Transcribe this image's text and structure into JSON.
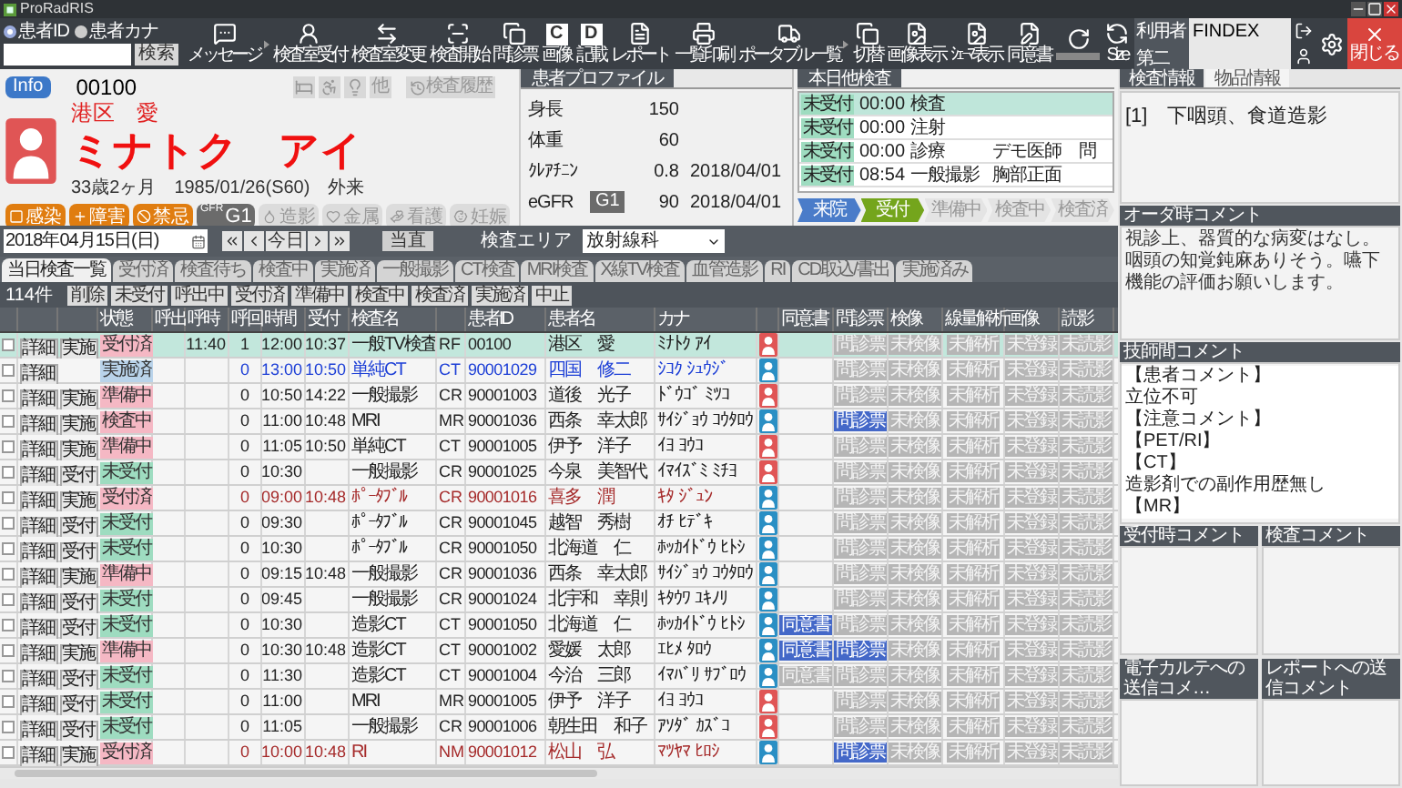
{
  "window": {
    "title": "ProRadRIS"
  },
  "search": {
    "modes": [
      {
        "label": "患者ID",
        "selected": true
      },
      {
        "label": "患者カナ",
        "selected": false
      }
    ],
    "button": "検索"
  },
  "toolbar": [
    {
      "kind": "icon",
      "label": "メッセージ"
    },
    {
      "kind": "icon",
      "label": "検査室受付"
    },
    {
      "kind": "icon",
      "label": "検査室変更"
    },
    {
      "kind": "icon",
      "label": "検査開始"
    },
    {
      "kind": "icon",
      "label": "問診票"
    },
    {
      "kind": "letter",
      "label": "画像",
      "glyph": "C"
    },
    {
      "kind": "letter",
      "label": "記載",
      "glyph": "D"
    },
    {
      "kind": "icon",
      "label": "レポート"
    },
    {
      "kind": "icon",
      "label": "一覧印刷"
    },
    {
      "kind": "icon",
      "label": "ポータブル一覧"
    },
    {
      "kind": "icon",
      "label": "切替"
    },
    {
      "kind": "icon",
      "label": "画像表示"
    },
    {
      "kind": "icon",
      "label": "ｼｪｰﾏ表示"
    },
    {
      "kind": "icon",
      "label": "同意書"
    },
    {
      "kind": "blank"
    },
    {
      "kind": "icon",
      "label": "Size"
    }
  ],
  "user": {
    "label": "利用者",
    "value": "FINDEX",
    "label2": "第二"
  },
  "close_button": "閉じる",
  "patient": {
    "info_badge": "Info",
    "id": "00100",
    "other_button": "他",
    "history_button": "検査履歴",
    "name": "港区　愛",
    "kana": "ミナトク　アイ",
    "avatar": {
      "color": "#e05555"
    },
    "age": "33歳2ヶ月",
    "birth": "1985/01/26(S60)",
    "visit": "外来",
    "flags": [
      {
        "kind": "flag",
        "label": "感染",
        "active": true
      },
      {
        "kind": "flag",
        "label": "障害",
        "active": true
      },
      {
        "kind": "flag",
        "label": "禁忌",
        "active": true
      },
      {
        "kind": "gfr",
        "small": "GFR",
        "label": "G1"
      },
      {
        "kind": "flag",
        "label": "造影",
        "active": false
      },
      {
        "kind": "flag",
        "label": "金属",
        "active": false
      },
      {
        "kind": "flag",
        "label": "看護",
        "active": false
      },
      {
        "kind": "flag",
        "label": "妊娠",
        "active": false
      }
    ]
  },
  "profile": {
    "title": "患者プロファイル",
    "rows": [
      {
        "label": "身長",
        "value": "150"
      },
      {
        "label": "体重",
        "value": "60"
      },
      {
        "label": "ｸﾚｱﾁﾆﾝ",
        "value": "0.8",
        "date": "2018/04/01"
      },
      {
        "label": "eGFR",
        "grade": "G1",
        "value": "90",
        "date": "2018/04/01"
      }
    ]
  },
  "today": {
    "title": "本日他検査",
    "rows": [
      {
        "status": "未受付",
        "time": "00:00",
        "exam": "検査",
        "selected": true
      },
      {
        "status": "未受付",
        "time": "00:00",
        "exam": "注射",
        "selected": false
      },
      {
        "status": "未受付",
        "time": "00:00",
        "exam": "診療",
        "note": "デモ医師　問",
        "selected": false
      },
      {
        "status": "未受付",
        "time": "08:54",
        "exam": "一般撮影",
        "note": "胸部正面",
        "selected": false
      }
    ],
    "steps": [
      {
        "label": "来院",
        "kind": "done"
      },
      {
        "label": "受付",
        "kind": "current"
      },
      {
        "label": "準備中",
        "kind": "todo"
      },
      {
        "label": "検査中",
        "kind": "todo"
      },
      {
        "label": "検査済",
        "kind": "todo"
      }
    ]
  },
  "date_bar": {
    "date": "2018年04月15日(日)",
    "today_button": "今日",
    "duty_button": "当直",
    "area_label": "検査エリア",
    "area_value": "放射線科"
  },
  "tabs": [
    {
      "label": "当日検査一覧",
      "selected": true
    },
    {
      "label": "受付済",
      "selected": false
    },
    {
      "label": "検査待ち",
      "selected": false
    },
    {
      "label": "検査中",
      "selected": false
    },
    {
      "label": "実施済",
      "selected": false
    },
    {
      "label": "一般撮影",
      "selected": false
    },
    {
      "label": "CT検査",
      "selected": false
    },
    {
      "label": "MRI検査",
      "selected": false
    },
    {
      "label": "X線TV検査",
      "selected": false
    },
    {
      "label": "血管造影",
      "selected": false
    },
    {
      "label": "RI",
      "selected": false
    },
    {
      "label": "CD取込/書出",
      "selected": false
    },
    {
      "label": "実施済み",
      "selected": false
    }
  ],
  "count": "114件",
  "filters": [
    "削除",
    "未受付",
    "呼出中",
    "受付済",
    "準備中",
    "検査中",
    "検査済",
    "実施済",
    "中止"
  ],
  "table": {
    "columns": [
      "状態",
      "呼出",
      "呼時",
      "呼回",
      "時間",
      "受付",
      "検査名",
      "患者ID",
      "患者名",
      "カナ",
      "同意書",
      "問診票",
      "検像",
      "線量解析",
      "画像",
      "読影"
    ],
    "rows": [
      {
        "checked": false,
        "selected": true,
        "kind": "normal",
        "detail": "詳細",
        "action": "実施",
        "status": {
          "label": "受付済",
          "color": "#f5b8c4"
        },
        "call_time": "11:40",
        "call_count": "1",
        "time": "12:00",
        "reception": "10:37",
        "exam": "一般TV検査",
        "modality": "RF",
        "patient_id": "00100",
        "name": "港区　愛",
        "kana": "ﾐﾅﾄｸ ｱｲ",
        "avatar": {
          "color": "#e05555"
        },
        "docs": [
          {
            "label": "問診票",
            "active": false
          },
          {
            "label": "未検像",
            "active": false
          },
          {
            "label": "未解析",
            "active": false
          },
          {
            "label": "未登録",
            "active": false
          },
          {
            "label": "未読影",
            "active": false
          }
        ]
      },
      {
        "checked": false,
        "selected": false,
        "kind": "done",
        "detail": "詳細",
        "status": {
          "label": "実施済",
          "color": "#b9d3ea"
        },
        "call_count": "0",
        "time": "13:00",
        "reception": "10:50",
        "exam": "単純CT",
        "modality": "CT",
        "patient_id": "90001029",
        "name": "四国　修二",
        "kana": "ｼｺｸ ｼｭｳｼﾞ",
        "avatar": {
          "color": "#2a8fc4"
        },
        "docs": [
          {
            "label": "問診票",
            "active": false
          },
          {
            "label": "未検像",
            "active": false
          },
          {
            "label": "未解析",
            "active": false
          },
          {
            "label": "未登録",
            "active": false
          },
          {
            "label": "未読影",
            "active": false
          }
        ]
      },
      {
        "checked": false,
        "selected": false,
        "kind": "normal",
        "detail": "詳細",
        "action": "実施",
        "status": {
          "label": "準備中",
          "color": "#f5b8c4"
        },
        "call_count": "0",
        "time": "10:50",
        "reception": "14:22",
        "exam": "一般撮影",
        "modality": "CR",
        "patient_id": "90001003",
        "name": "道後　光子",
        "kana": "ﾄﾞｳｺﾞ ﾐﾂｺ",
        "avatar": {
          "color": "#e05555"
        },
        "docs": [
          {
            "label": "問診票",
            "active": false
          },
          {
            "label": "未検像",
            "active": false
          },
          {
            "label": "未解析",
            "active": false
          },
          {
            "label": "未登録",
            "active": false
          },
          {
            "label": "未読影",
            "active": false
          }
        ]
      },
      {
        "checked": false,
        "selected": false,
        "kind": "normal",
        "detail": "詳細",
        "action": "実施",
        "status": {
          "label": "検査中",
          "color": "#f5b8c4"
        },
        "call_count": "0",
        "time": "11:00",
        "reception": "10:48",
        "exam": "MRI",
        "modality": "MR",
        "patient_id": "90001036",
        "name": "西条　幸太郎",
        "kana": "ｻｲｼﾞｮｳ ｺｳﾀﾛｳ",
        "avatar": {
          "color": "#2a8fc4"
        },
        "docs": [
          {
            "label": "問診票",
            "active": true
          },
          {
            "label": "未検像",
            "active": false
          },
          {
            "label": "未解析",
            "active": false
          },
          {
            "label": "未登録",
            "active": false
          },
          {
            "label": "未読影",
            "active": false
          }
        ]
      },
      {
        "checked": false,
        "selected": false,
        "kind": "normal",
        "detail": "詳細",
        "action": "実施",
        "status": {
          "label": "準備中",
          "color": "#f5b8c4"
        },
        "call_count": "0",
        "time": "11:05",
        "reception": "10:50",
        "exam": "単純CT",
        "modality": "CT",
        "patient_id": "90001005",
        "name": "伊予　洋子",
        "kana": "ｲﾖ ﾖｳｺ",
        "avatar": {
          "color": "#e05555"
        },
        "docs": [
          {
            "label": "問診票",
            "active": false
          },
          {
            "label": "未検像",
            "active": false
          },
          {
            "label": "未解析",
            "active": false
          },
          {
            "label": "未登録",
            "active": false
          },
          {
            "label": "未読影",
            "active": false
          }
        ]
      },
      {
        "checked": false,
        "selected": false,
        "kind": "normal",
        "detail": "詳細",
        "action": "受付",
        "status": {
          "label": "未受付",
          "color": "#9edcc0"
        },
        "call_count": "0",
        "time": "10:30",
        "exam": "一般撮影",
        "modality": "CR",
        "patient_id": "90001025",
        "name": "今泉　美智代",
        "kana": "ｲﾏｲｽﾞﾐ ﾐﾁﾖ",
        "avatar": {
          "color": "#e05555"
        },
        "docs": [
          {
            "label": "問診票",
            "active": false
          },
          {
            "label": "未検像",
            "active": false
          },
          {
            "label": "未解析",
            "active": false
          },
          {
            "label": "未登録",
            "active": false
          },
          {
            "label": "未読影",
            "active": false
          }
        ]
      },
      {
        "checked": false,
        "selected": false,
        "kind": "received",
        "detail": "詳細",
        "action": "実施",
        "status": {
          "label": "受付済",
          "color": "#f5b8c4"
        },
        "call_count": "0",
        "time": "09:00",
        "reception": "10:48",
        "exam": "ﾎﾟｰﾀﾌﾞﾙ",
        "modality": "CR",
        "patient_id": "90001016",
        "name": "喜多　潤",
        "kana": "ｷﾀ ｼﾞｭﾝ",
        "avatar": {
          "color": "#2a8fc4"
        },
        "docs": [
          {
            "label": "問診票",
            "active": false
          },
          {
            "label": "未検像",
            "active": false
          },
          {
            "label": "未解析",
            "active": false
          },
          {
            "label": "未登録",
            "active": false
          },
          {
            "label": "未読影",
            "active": false
          }
        ]
      },
      {
        "checked": false,
        "selected": false,
        "kind": "normal",
        "detail": "詳細",
        "action": "受付",
        "status": {
          "label": "未受付",
          "color": "#9edcc0"
        },
        "call_count": "0",
        "time": "09:30",
        "exam": "ﾎﾟｰﾀﾌﾞﾙ",
        "modality": "CR",
        "patient_id": "90001045",
        "name": "越智　秀樹",
        "kana": "ｵﾁ ﾋﾃﾞｷ",
        "avatar": {
          "color": "#2a8fc4"
        },
        "docs": [
          {
            "label": "問診票",
            "active": false
          },
          {
            "label": "未検像",
            "active": false
          },
          {
            "label": "未解析",
            "active": false
          },
          {
            "label": "未登録",
            "active": false
          },
          {
            "label": "未読影",
            "active": false
          }
        ]
      },
      {
        "checked": false,
        "selected": false,
        "kind": "normal",
        "detail": "詳細",
        "action": "受付",
        "status": {
          "label": "未受付",
          "color": "#9edcc0"
        },
        "call_count": "0",
        "time": "10:30",
        "exam": "ﾎﾟｰﾀﾌﾞﾙ",
        "modality": "CR",
        "patient_id": "90001050",
        "name": "北海道　仁",
        "kana": "ﾎｯｶｲﾄﾞｳ ﾋﾄｼ",
        "avatar": {
          "color": "#2a8fc4"
        },
        "docs": [
          {
            "label": "問診票",
            "active": false
          },
          {
            "label": "未検像",
            "active": false
          },
          {
            "label": "未解析",
            "active": false
          },
          {
            "label": "未登録",
            "active": false
          },
          {
            "label": "未読影",
            "active": false
          }
        ]
      },
      {
        "checked": false,
        "selected": false,
        "kind": "normal",
        "detail": "詳細",
        "action": "実施",
        "status": {
          "label": "準備中",
          "color": "#f5b8c4"
        },
        "call_count": "0",
        "time": "09:15",
        "reception": "10:48",
        "exam": "一般撮影",
        "modality": "CR",
        "patient_id": "90001036",
        "name": "西条　幸太郎",
        "kana": "ｻｲｼﾞｮｳ ｺｳﾀﾛｳ",
        "avatar": {
          "color": "#2a8fc4"
        },
        "docs": [
          {
            "label": "問診票",
            "active": false
          },
          {
            "label": "未検像",
            "active": false
          },
          {
            "label": "未解析",
            "active": false
          },
          {
            "label": "未登録",
            "active": false
          },
          {
            "label": "未読影",
            "active": false
          }
        ]
      },
      {
        "checked": false,
        "selected": false,
        "kind": "normal",
        "detail": "詳細",
        "action": "受付",
        "status": {
          "label": "未受付",
          "color": "#9edcc0"
        },
        "call_count": "0",
        "time": "09:45",
        "exam": "一般撮影",
        "modality": "CR",
        "patient_id": "90001024",
        "name": "北宇和　幸則",
        "kana": "ｷﾀｳﾜ ﾕｷﾉﾘ",
        "avatar": {
          "color": "#2a8fc4"
        },
        "docs": [
          {
            "label": "問診票",
            "active": false
          },
          {
            "label": "未検像",
            "active": false
          },
          {
            "label": "未解析",
            "active": false
          },
          {
            "label": "未登録",
            "active": false
          },
          {
            "label": "未読影",
            "active": false
          }
        ]
      },
      {
        "checked": false,
        "selected": false,
        "kind": "normal",
        "detail": "詳細",
        "action": "受付",
        "status": {
          "label": "未受付",
          "color": "#9edcc0"
        },
        "call_count": "0",
        "time": "10:30",
        "exam": "造影CT",
        "modality": "CT",
        "patient_id": "90001050",
        "name": "北海道　仁",
        "kana": "ﾎｯｶｲﾄﾞｳ ﾋﾄｼ",
        "avatar": {
          "color": "#2a8fc4"
        },
        "consent": {
          "label": "同意書",
          "active": true
        },
        "docs": [
          {
            "label": "問診票",
            "active": false
          },
          {
            "label": "未検像",
            "active": false
          },
          {
            "label": "未解析",
            "active": false
          },
          {
            "label": "未登録",
            "active": false
          },
          {
            "label": "未読影",
            "active": false
          }
        ]
      },
      {
        "checked": false,
        "selected": false,
        "kind": "normal",
        "detail": "詳細",
        "action": "実施",
        "status": {
          "label": "準備中",
          "color": "#f5b8c4"
        },
        "call_count": "0",
        "time": "10:30",
        "reception": "10:48",
        "exam": "造影CT",
        "modality": "CT",
        "patient_id": "90001002",
        "name": "愛媛　太郎",
        "kana": "ｴﾋﾒ ﾀﾛｳ",
        "avatar": {
          "color": "#2a8fc4"
        },
        "consent": {
          "label": "同意書",
          "active": true
        },
        "docs": [
          {
            "label": "問診票",
            "active": true
          },
          {
            "label": "未検像",
            "active": false
          },
          {
            "label": "未解析",
            "active": false
          },
          {
            "label": "未登録",
            "active": false
          },
          {
            "label": "未読影",
            "active": false
          }
        ]
      },
      {
        "checked": false,
        "selected": false,
        "kind": "normal",
        "detail": "詳細",
        "action": "受付",
        "status": {
          "label": "未受付",
          "color": "#9edcc0"
        },
        "call_count": "0",
        "time": "11:30",
        "exam": "造影CT",
        "modality": "CT",
        "patient_id": "90001004",
        "name": "今治　三郎",
        "kana": "ｲﾏﾊﾞﾘ ｻﾌﾞﾛｳ",
        "avatar": {
          "color": "#2a8fc4"
        },
        "consent": {
          "label": "同意書",
          "active": false
        },
        "docs": [
          {
            "label": "問診票",
            "active": false
          },
          {
            "label": "未検像",
            "active": false
          },
          {
            "label": "未解析",
            "active": false
          },
          {
            "label": "未登録",
            "active": false
          },
          {
            "label": "未読影",
            "active": false
          }
        ]
      },
      {
        "checked": false,
        "selected": false,
        "kind": "normal",
        "detail": "詳細",
        "action": "受付",
        "status": {
          "label": "未受付",
          "color": "#9edcc0"
        },
        "call_count": "0",
        "time": "11:00",
        "exam": "MRI",
        "modality": "MR",
        "patient_id": "90001005",
        "name": "伊予　洋子",
        "kana": "ｲﾖ ﾖｳｺ",
        "avatar": {
          "color": "#e05555"
        },
        "docs": [
          {
            "label": "問診票",
            "active": false
          },
          {
            "label": "未検像",
            "active": false
          },
          {
            "label": "未解析",
            "active": false
          },
          {
            "label": "未登録",
            "active": false
          },
          {
            "label": "未読影",
            "active": false
          }
        ]
      },
      {
        "checked": false,
        "selected": false,
        "kind": "normal",
        "detail": "詳細",
        "action": "受付",
        "status": {
          "label": "未受付",
          "color": "#9edcc0"
        },
        "call_count": "0",
        "time": "11:05",
        "exam": "一般撮影",
        "modality": "CR",
        "patient_id": "90001006",
        "name": "朝生田　和子",
        "kana": "ｱｿﾀﾞ ｶｽﾞｺ",
        "avatar": {
          "color": "#e05555"
        },
        "docs": [
          {
            "label": "問診票",
            "active": false
          },
          {
            "label": "未検像",
            "active": false
          },
          {
            "label": "未解析",
            "active": false
          },
          {
            "label": "未登録",
            "active": false
          },
          {
            "label": "未読影",
            "active": false
          }
        ]
      },
      {
        "checked": false,
        "selected": false,
        "kind": "received",
        "detail": "詳細",
        "action": "実施",
        "status": {
          "label": "受付済",
          "color": "#f5b8c4"
        },
        "call_count": "0",
        "time": "10:00",
        "reception": "10:48",
        "exam": "RI",
        "modality": "NM",
        "patient_id": "90001012",
        "name": "松山　弘",
        "kana": "ﾏﾂﾔﾏ ﾋﾛｼ",
        "avatar": {
          "color": "#2a8fc4"
        },
        "docs": [
          {
            "label": "問診票",
            "active": true
          },
          {
            "label": "未検像",
            "active": false
          },
          {
            "label": "未解析",
            "active": false
          },
          {
            "label": "未登録",
            "active": false
          },
          {
            "label": "未読影",
            "active": false
          }
        ]
      }
    ]
  },
  "side": {
    "tabs": [
      {
        "label": "検査情報",
        "selected": true
      },
      {
        "label": "物品情報",
        "selected": false
      }
    ],
    "exam_info": "[1]　下咽頭、食道造影",
    "order_comment": {
      "title": "オーダ時コメント",
      "text": "視診上、器質的な病変はなし。咽頭の知覚鈍麻ありそう。嚥下機能の評価お願いします。"
    },
    "tech_comment": {
      "title": "技師間コメント",
      "lines": [
        "【患者コメント】",
        "立位不可",
        "【注意コメント】",
        "【PET/RI】",
        "【CT】",
        "造影剤での副作用歴無し",
        "【MR】"
      ]
    },
    "boxes": [
      {
        "title": "受付時コメント"
      },
      {
        "title": "検査コメント"
      },
      {
        "title": "電子カルテへの送信コメ…"
      },
      {
        "title": "レポートへの送信コメント"
      }
    ]
  }
}
